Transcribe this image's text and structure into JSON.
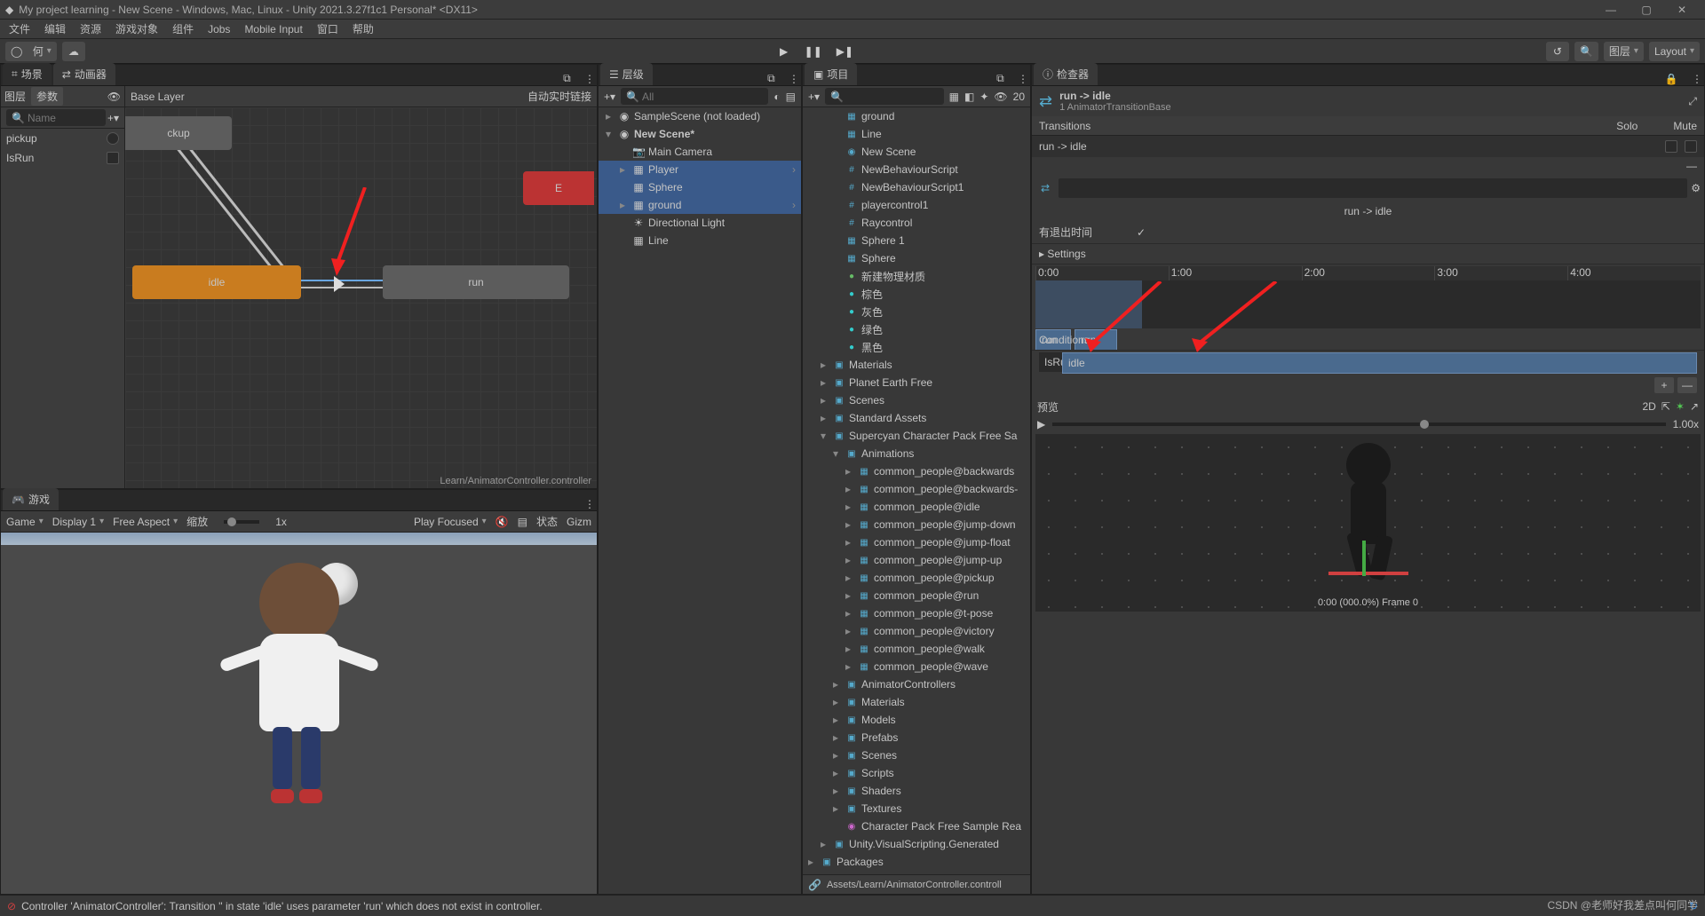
{
  "title": "My project learning - New Scene - Windows, Mac, Linux - Unity 2021.3.27f1c1 Personal* <DX11>",
  "menu": [
    "文件",
    "编辑",
    "资源",
    "游戏对象",
    "组件",
    "Jobs",
    "Mobile Input",
    "窗口",
    "帮助"
  ],
  "toolbar": {
    "account": "何",
    "layers": "图层",
    "layout": "Layout"
  },
  "left": {
    "tabs": {
      "scene": "场景",
      "animator": "动画器"
    },
    "sub": {
      "layer": "图层",
      "params": "参数",
      "baseLayer": "Base Layer",
      "autoLive": "自动实时链接"
    },
    "paramSearch": "Name",
    "params": [
      {
        "name": "pickup"
      },
      {
        "name": "IsRun"
      }
    ],
    "states": {
      "pickup": "ckup",
      "idle": "idle",
      "run": "run",
      "exit": "E"
    },
    "path": "Learn/AnimatorController.controller"
  },
  "game": {
    "tab": "游戏",
    "dd1": "Game",
    "dd2": "Display 1",
    "dd3": "Free Aspect",
    "scale": "缩放",
    "scaleVal": "1x",
    "play": "Play Focused",
    "muteLabel": "静",
    "stats": "状态",
    "gizmos": "Gizm"
  },
  "hierarchy": {
    "tab": "层级",
    "search": "All",
    "items": [
      {
        "t": "SampleScene (not loaded)",
        "ico": "◉",
        "dim": true,
        "indent": 0,
        "fold": "▸"
      },
      {
        "t": "New Scene*",
        "ico": "◉",
        "bold": true,
        "indent": 0,
        "fold": "▾"
      },
      {
        "t": "Main Camera",
        "ico": "📷",
        "indent": 1
      },
      {
        "t": "Player",
        "ico": "▦",
        "indent": 1,
        "fold": "▸",
        "arrow": true,
        "sel": true
      },
      {
        "t": "Sphere",
        "ico": "▦",
        "indent": 1,
        "sel": true
      },
      {
        "t": "ground",
        "ico": "▦",
        "indent": 1,
        "fold": "▸",
        "arrow": true,
        "sel": true
      },
      {
        "t": "Directional Light",
        "ico": "☀",
        "indent": 1
      },
      {
        "t": "Line",
        "ico": "▦",
        "indent": 1,
        "dim": true
      }
    ]
  },
  "project": {
    "tab": "项目",
    "search": "",
    "count": "20",
    "items": [
      {
        "t": "ground",
        "ico": "▦",
        "i": 2
      },
      {
        "t": "Line",
        "ico": "▦",
        "i": 2
      },
      {
        "t": "New Scene",
        "ico": "◉",
        "i": 2
      },
      {
        "t": "NewBehaviourScript",
        "ico": "#",
        "i": 2
      },
      {
        "t": "NewBehaviourScript1",
        "ico": "#",
        "i": 2
      },
      {
        "t": "playercontrol1",
        "ico": "#",
        "i": 2
      },
      {
        "t": "Raycontrol",
        "ico": "#",
        "i": 2
      },
      {
        "t": "Sphere 1",
        "ico": "▦",
        "i": 2
      },
      {
        "t": "Sphere",
        "ico": "▦",
        "i": 2
      },
      {
        "t": "新建物理材质",
        "ico": "●",
        "i": 2,
        "c": "#6b6"
      },
      {
        "t": "棕色",
        "ico": "●",
        "i": 2,
        "c": "#3cc"
      },
      {
        "t": "灰色",
        "ico": "●",
        "i": 2,
        "c": "#3cc"
      },
      {
        "t": "绿色",
        "ico": "●",
        "i": 2,
        "c": "#3cc"
      },
      {
        "t": "黑色",
        "ico": "●",
        "i": 2,
        "c": "#3cc"
      },
      {
        "t": "Materials",
        "ico": "▣",
        "i": 1,
        "fold": "▸"
      },
      {
        "t": "Planet Earth Free",
        "ico": "▣",
        "i": 1,
        "fold": "▸"
      },
      {
        "t": "Scenes",
        "ico": "▣",
        "i": 1,
        "fold": "▸"
      },
      {
        "t": "Standard Assets",
        "ico": "▣",
        "i": 1,
        "fold": "▸"
      },
      {
        "t": "Supercyan Character Pack Free Sa",
        "ico": "▣",
        "i": 1,
        "fold": "▾"
      },
      {
        "t": "Animations",
        "ico": "▣",
        "i": 2,
        "fold": "▾"
      },
      {
        "t": "common_people@backwards",
        "ico": "▦",
        "i": 3,
        "fold": "▸"
      },
      {
        "t": "common_people@backwards-",
        "ico": "▦",
        "i": 3,
        "fold": "▸"
      },
      {
        "t": "common_people@idle",
        "ico": "▦",
        "i": 3,
        "fold": "▸"
      },
      {
        "t": "common_people@jump-down",
        "ico": "▦",
        "i": 3,
        "fold": "▸"
      },
      {
        "t": "common_people@jump-float",
        "ico": "▦",
        "i": 3,
        "fold": "▸"
      },
      {
        "t": "common_people@jump-up",
        "ico": "▦",
        "i": 3,
        "fold": "▸"
      },
      {
        "t": "common_people@pickup",
        "ico": "▦",
        "i": 3,
        "fold": "▸"
      },
      {
        "t": "common_people@run",
        "ico": "▦",
        "i": 3,
        "fold": "▸"
      },
      {
        "t": "common_people@t-pose",
        "ico": "▦",
        "i": 3,
        "fold": "▸"
      },
      {
        "t": "common_people@victory",
        "ico": "▦",
        "i": 3,
        "fold": "▸"
      },
      {
        "t": "common_people@walk",
        "ico": "▦",
        "i": 3,
        "fold": "▸"
      },
      {
        "t": "common_people@wave",
        "ico": "▦",
        "i": 3,
        "fold": "▸"
      },
      {
        "t": "AnimatorControllers",
        "ico": "▣",
        "i": 2,
        "fold": "▸"
      },
      {
        "t": "Materials",
        "ico": "▣",
        "i": 2,
        "fold": "▸"
      },
      {
        "t": "Models",
        "ico": "▣",
        "i": 2,
        "fold": "▸"
      },
      {
        "t": "Prefabs",
        "ico": "▣",
        "i": 2,
        "fold": "▸"
      },
      {
        "t": "Scenes",
        "ico": "▣",
        "i": 2,
        "fold": "▸"
      },
      {
        "t": "Scripts",
        "ico": "▣",
        "i": 2,
        "fold": "▸"
      },
      {
        "t": "Shaders",
        "ico": "▣",
        "i": 2,
        "fold": "▸"
      },
      {
        "t": "Textures",
        "ico": "▣",
        "i": 2,
        "fold": "▸"
      },
      {
        "t": "Character Pack Free Sample Rea",
        "ico": "◉",
        "i": 2,
        "c": "#c6c"
      },
      {
        "t": "Unity.VisualScripting.Generated",
        "ico": "▣",
        "i": 1,
        "fold": "▸"
      },
      {
        "t": "Packages",
        "ico": "▣",
        "i": 0,
        "fold": "▸"
      }
    ],
    "path": "Assets/Learn/AnimatorController.controll"
  },
  "inspector": {
    "tab": "检查器",
    "title": "run -> idle",
    "sub": "1 AnimatorTransitionBase",
    "transHeader": "Transitions",
    "solo": "Solo",
    "mute": "Mute",
    "row": "run -> idle",
    "label": "run -> idle",
    "hasExit": "有退出时间",
    "settings": "Settings",
    "ticks": [
      "0:00",
      "1:00",
      "2:00",
      "3:00",
      "4:00"
    ],
    "clip1": "run",
    "clip2": "run",
    "clip3": "idle",
    "conditions": "Conditions",
    "condParam": "IsRun",
    "condVal": "false",
    "preview": "预览",
    "p2d": "2D",
    "speed": "1.00x",
    "frameInfo": "0:00 (000.0%) Frame 0"
  },
  "error": "Controller 'AnimatorController': Transition '' in state 'idle' uses parameter 'run' which does not exist in controller.",
  "watermark": "CSDN @老师好我差点叫何同学"
}
